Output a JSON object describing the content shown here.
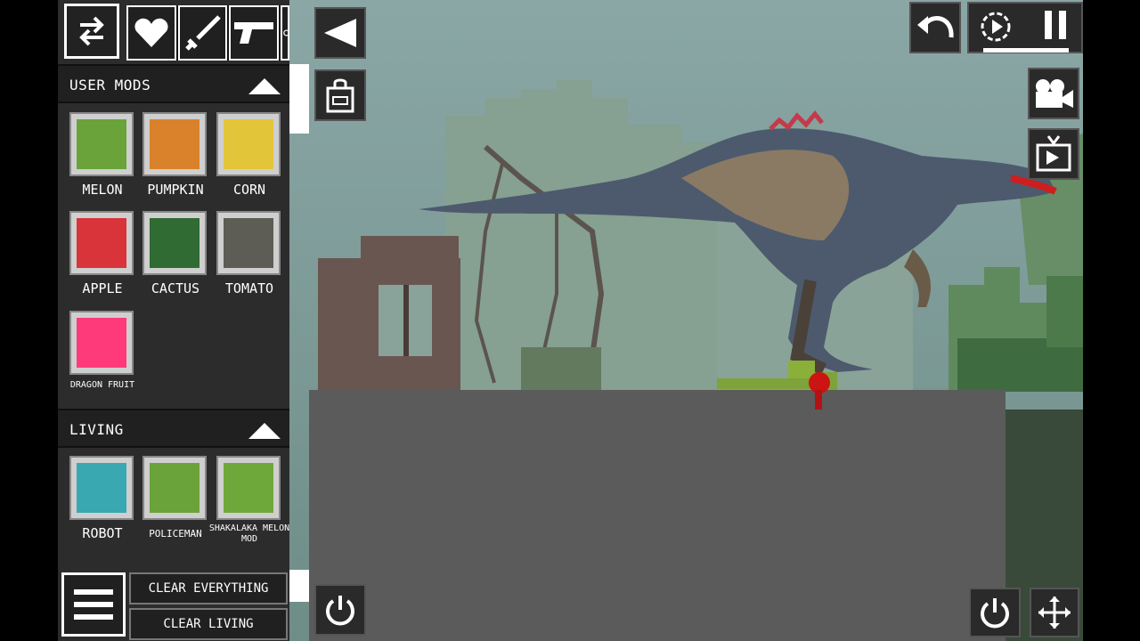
{
  "toolbar": {
    "swap_icon": "swap-arrows-icon",
    "categories": [
      "heart-icon",
      "sword-icon",
      "pistol-icon",
      "explosive-icon"
    ]
  },
  "sections": {
    "user_mods": {
      "title": "USER MODS",
      "items": [
        {
          "label": "MELON",
          "color": "#6aa33a"
        },
        {
          "label": "PUMPKIN",
          "color": "#d9822b"
        },
        {
          "label": "CORN",
          "color": "#e3c53a"
        },
        {
          "label": "APPLE",
          "color": "#d8343a"
        },
        {
          "label": "CACTUS",
          "color": "#2f6b33"
        },
        {
          "label": "TOMATO",
          "color": "#5d5c55"
        },
        {
          "label": "DRAGON FRUIT",
          "color": "#ff3a7a"
        }
      ]
    },
    "living": {
      "title": "LIVING",
      "items": [
        {
          "label": "ROBOT",
          "color": "#3aa8b0"
        },
        {
          "label": "POLICEMAN",
          "color": "#6aa33a"
        },
        {
          "label": "SHAKALAKA MELON MOD",
          "color": "#6fa83a"
        }
      ]
    }
  },
  "buttons": {
    "clear_everything": "CLEAR EVERYTHING",
    "clear_living": "CLEAR LIVING"
  },
  "colors": {
    "sky": "#7d9a97",
    "ground": "#5b5b5b",
    "sidebar": "#2c2c2c",
    "accent_red": "#ff1a1a"
  }
}
